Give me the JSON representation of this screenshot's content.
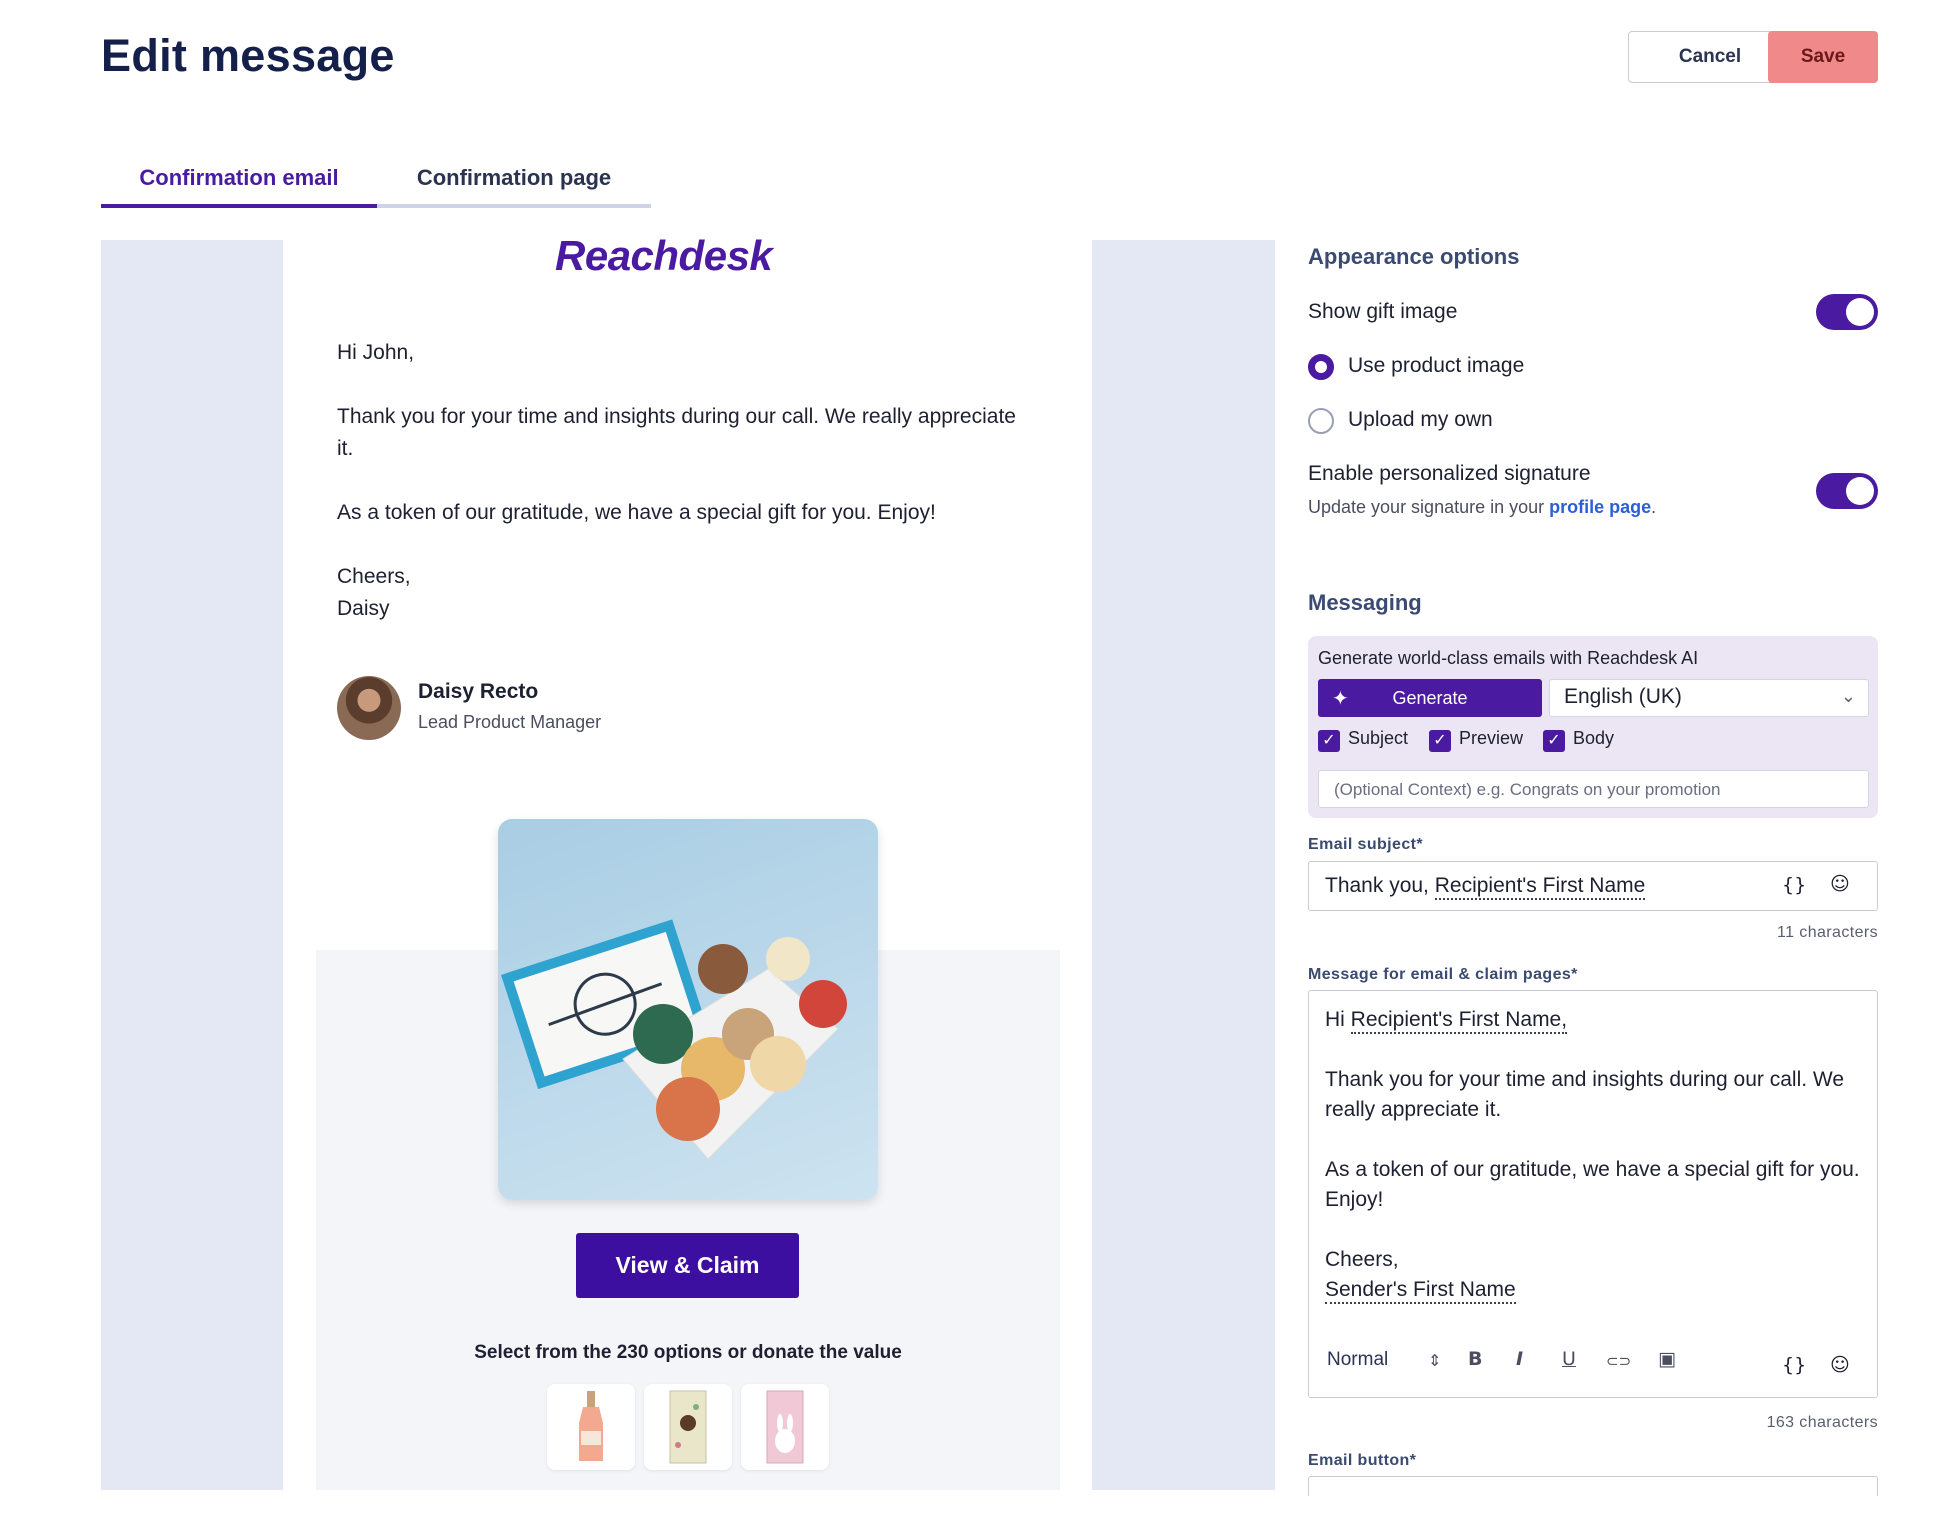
{
  "header": {
    "title": "Edit message",
    "cancel_label": "Cancel",
    "save_label": "Save"
  },
  "tabs": [
    {
      "label": "Confirmation email",
      "active": true
    },
    {
      "label": "Confirmation page",
      "active": false
    }
  ],
  "preview": {
    "logo_text": "Reachdesk",
    "greeting": "Hi John,",
    "paragraph1": "Thank you for your time and insights during our call. We really appreciate it.",
    "paragraph2": "As a token of our gratitude, we have a special gift for you. Enjoy!",
    "closing": "Cheers,",
    "closing_name": "Daisy",
    "signature_name": "Daisy Recto",
    "signature_title": "Lead Product Manager",
    "claim_button": "View & Claim",
    "options_text": "Select from the 230 options or donate the value"
  },
  "appearance": {
    "title": "Appearance options",
    "show_gift_image_label": "Show gift image",
    "show_gift_image": true,
    "radio_product": "Use product image",
    "radio_upload": "Upload my own",
    "selected_radio": "Use product image",
    "signature_label": "Enable personalized signature",
    "signature_enabled": true,
    "helper_prefix": "Update your signature in your ",
    "helper_link": "profile page",
    "helper_suffix": "."
  },
  "messaging": {
    "title": "Messaging",
    "ai_title": "Generate world-class emails with Reachdesk AI",
    "generate_label": "Generate",
    "language": "English (UK)",
    "checkboxes": [
      {
        "label": "Subject",
        "checked": true
      },
      {
        "label": "Preview",
        "checked": true
      },
      {
        "label": "Body",
        "checked": true
      }
    ],
    "context_placeholder": "(Optional Context) e.g. Congrats on your promotion",
    "subject_label": "Email subject*",
    "subject_prefix": "Thank you, ",
    "subject_variable": "Recipient's First Name",
    "subject_count": "11 characters",
    "message_label": "Message for email & claim pages*",
    "message_greeting_prefix": "Hi ",
    "message_greeting_variable": "Recipient's First Name,",
    "message_p1": "Thank you for your time and insights during our call. We really appreciate it.",
    "message_p2": "As a token of our gratitude, we have a special gift for you. Enjoy!",
    "message_closing": "Cheers,",
    "message_sender_variable": "Sender's First Name",
    "toolbar_style": "Normal",
    "message_count": "163 characters",
    "button_label": "Email button*"
  },
  "icons": {
    "variable": "{}",
    "emoji": "☺",
    "bold": "B",
    "italic": "I",
    "underline": "U",
    "link": "⊂⊃",
    "image": "▣",
    "sparkle": "✦",
    "chevron": "⌄",
    "updown": "⇕",
    "check": "✓"
  },
  "colors": {
    "brand_purple": "#4a1ba0",
    "save_bg": "#f08a8a",
    "link_blue": "#2b5fd9"
  }
}
